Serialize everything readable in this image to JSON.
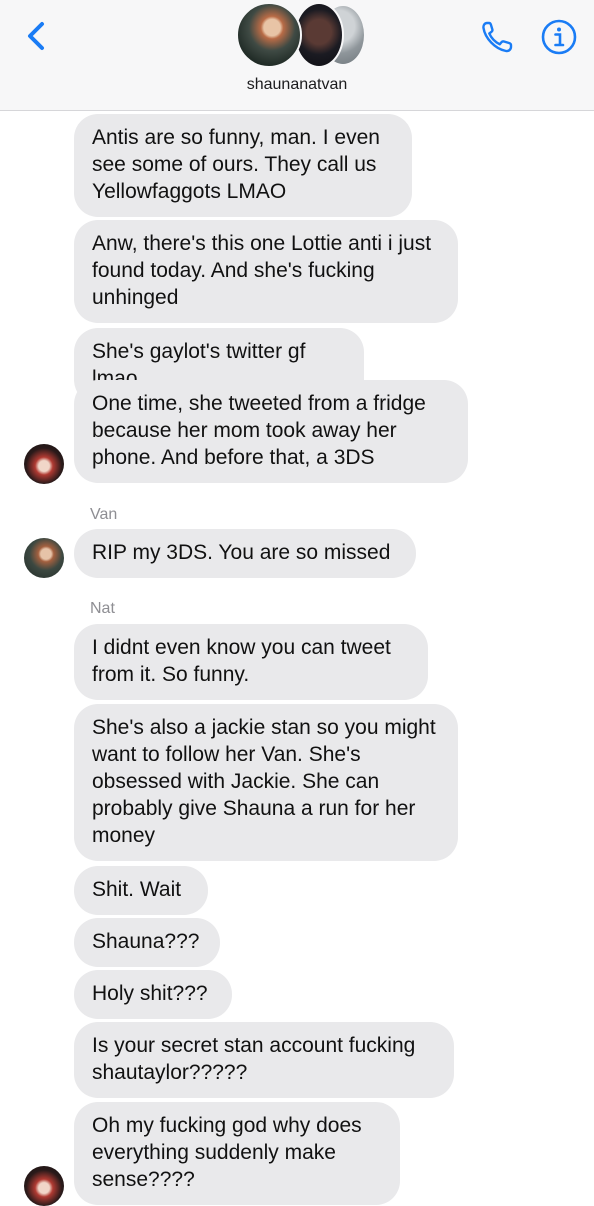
{
  "header": {
    "chat_name": "shaunanatvan",
    "icons": [
      "back-chevron-icon",
      "phone-icon",
      "info-icon"
    ],
    "accent_color": "#1a7cf5"
  },
  "messages": [
    {
      "text": "Antis are so funny, man. I even see some of ours. They call us Yellowfaggots LMAO"
    },
    {
      "text": "Anw, there's this one Lottie anti i just found today. And she's fucking unhinged"
    },
    {
      "text": "She's gaylot's twitter gf lmao"
    },
    {
      "text": "One time, she tweeted from a fridge because her mom took away her phone. And before that, a 3DS"
    },
    {
      "sender": "Van",
      "text": "RIP my 3DS. You are so missed"
    },
    {
      "sender": "Nat",
      "text": "I didnt even know you can tweet from it. So funny."
    },
    {
      "text": "She's also a jackie stan so you might want to follow her Van. She's obsessed with Jackie. She can probably give Shauna a run for her money"
    },
    {
      "text": "Shit. Wait"
    },
    {
      "text": "Shauna???"
    },
    {
      "text": "Holy shit???"
    },
    {
      "text": "Is your secret stan account fucking shautaylor?????"
    },
    {
      "text": "Oh my fucking god why does everything suddenly make sense????"
    }
  ]
}
